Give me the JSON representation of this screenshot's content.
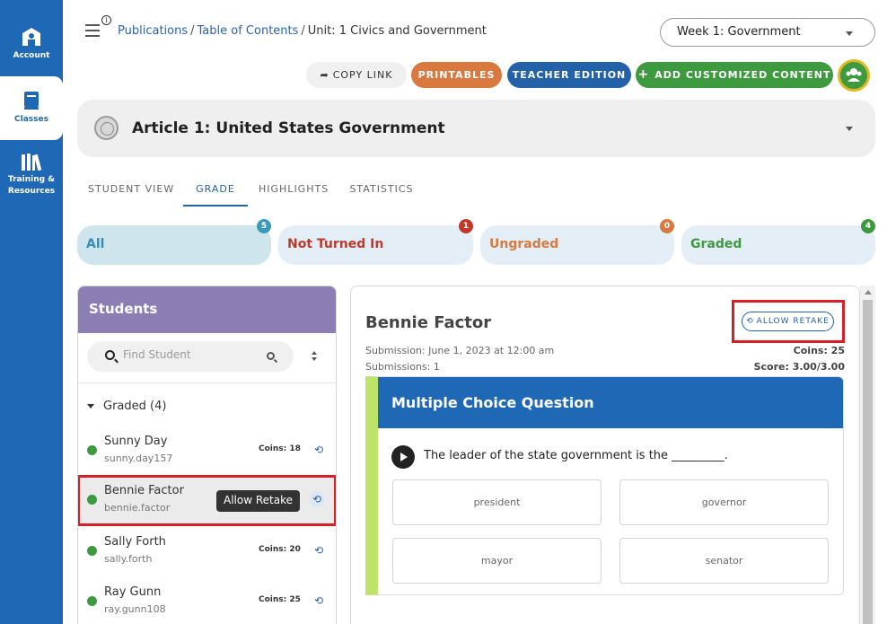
{
  "sidenav": {
    "items": [
      {
        "label": "Account"
      },
      {
        "label": "Classes"
      },
      {
        "label": "Training & Resources"
      }
    ]
  },
  "header": {
    "breadcrumb": {
      "publications": "Publications",
      "toc": "Table of Contents",
      "sep": "/",
      "current": "Unit: 1 Civics and Government"
    },
    "week_select": "Week 1: Government",
    "buttons": {
      "copy_link": "COPY LINK",
      "printables": "PRINTABLES",
      "teacher_edition": "TEACHER EDITION",
      "add_content": "ADD CUSTOMIZED CONTENT"
    }
  },
  "article": {
    "title": "Article 1: United States Government"
  },
  "tabs": [
    "STUDENT VIEW",
    "GRADE",
    "HIGHLIGHTS",
    "STATISTICS"
  ],
  "filters": [
    {
      "label": "All",
      "count": "5"
    },
    {
      "label": "Not Turned In",
      "count": "1"
    },
    {
      "label": "Ungraded",
      "count": "0"
    },
    {
      "label": "Graded",
      "count": "4"
    }
  ],
  "students": {
    "title": "Students",
    "search_placeholder": "Find Student",
    "group": "Graded (4)",
    "rows": [
      {
        "name": "Sunny Day",
        "username": "sunny.day157",
        "coins": "Coins: 18"
      },
      {
        "name": "Bennie Factor",
        "username": "bennie.factor",
        "tooltip": "Allow Retake"
      },
      {
        "name": "Sally Forth",
        "username": "sally.forth",
        "coins": "Coins: 20"
      },
      {
        "name": "Ray Gunn",
        "username": "ray.gunn108",
        "coins": "Coins: 25"
      }
    ]
  },
  "submission": {
    "student_name": "Bennie Factor",
    "allow_retake": "ALLOW RETAKE",
    "date": "Submission: June 1, 2023 at 12:00 am",
    "count": "Submissions: 1",
    "coins": "Coins: 25",
    "score": "Score: 3.00/3.00",
    "question": {
      "heading": "Multiple Choice Question",
      "text": "The leader of the state government is the _________.",
      "choices": [
        "president",
        "governor",
        "mayor",
        "senator"
      ]
    }
  },
  "colors": {
    "nav_blue": "#1f68b5",
    "students_header": "#8c7db5",
    "highlight_red": "#d91f26",
    "graded_green": "#3d9a3e"
  }
}
